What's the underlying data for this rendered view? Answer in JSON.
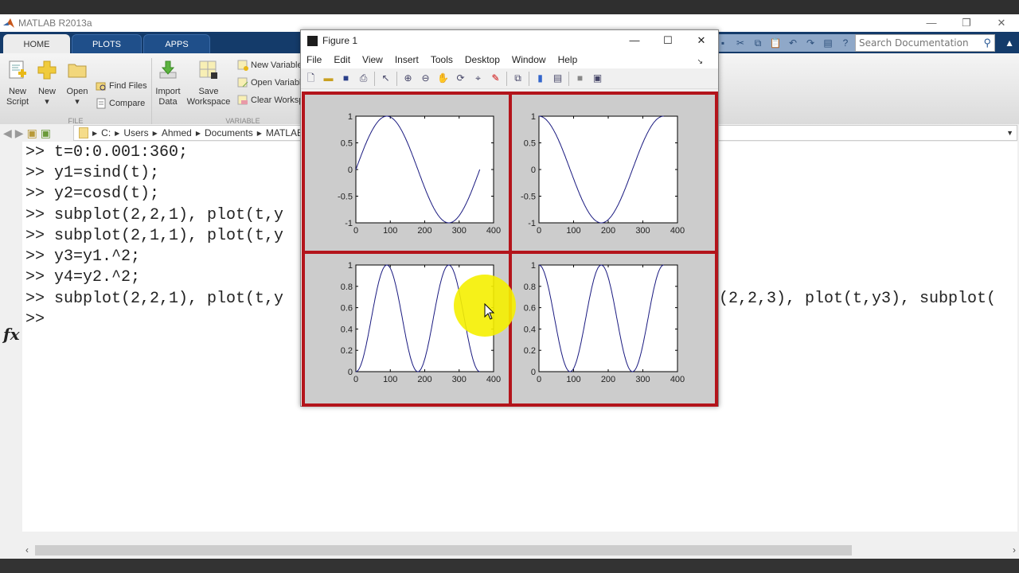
{
  "app": {
    "title": "MATLAB R2013a",
    "window_controls": [
      "minimize",
      "restore",
      "close"
    ],
    "tabs": [
      {
        "label": "HOME",
        "active": true
      },
      {
        "label": "PLOTS",
        "active": false
      },
      {
        "label": "APPS",
        "active": false
      }
    ],
    "search_placeholder": "Search Documentation"
  },
  "ribbon": {
    "file_group": {
      "label": "FILE",
      "buttons": [
        {
          "label_line1": "New",
          "label_line2": "Script",
          "icon": "new-script-icon"
        },
        {
          "label_line1": "New",
          "label_line2": "▾",
          "icon": "plus-icon"
        },
        {
          "label_line1": "Open",
          "label_line2": "▾",
          "icon": "folder-icon"
        }
      ],
      "small_buttons": [
        {
          "label": "Find Files",
          "icon": "find-files-icon"
        },
        {
          "label": "Compare",
          "icon": "compare-icon"
        }
      ]
    },
    "variable_group": {
      "label": "VARIABLE",
      "buttons": [
        {
          "label_line1": "Import",
          "label_line2": "Data",
          "icon": "import-icon"
        },
        {
          "label_line1": "Save",
          "label_line2": "Workspace",
          "icon": "save-workspace-icon"
        }
      ],
      "small_buttons": [
        {
          "label": "New Variable",
          "icon": "new-variable-icon"
        },
        {
          "label": "Open Variable",
          "icon": "open-variable-icon"
        },
        {
          "label": "Clear Workspace",
          "icon": "clear-workspace-icon"
        }
      ]
    }
  },
  "address_bar": {
    "path": [
      "C:",
      "Users",
      "Ahmed",
      "Documents",
      "MATLAB"
    ]
  },
  "command_window": {
    "prompt": ">>",
    "lines": [
      ">> t=0:0.001:360;",
      ">> y1=sind(t);",
      ">> y2=cosd(t);",
      ">> subplot(2,2,1), plot(t,y",
      ">> subplot(2,1,1), plot(t,y",
      ">> y3=y1.^2;",
      ">> y4=y2.^2;",
      ">> subplot(2,2,1), plot(t,y"
    ],
    "line8_tail": "(2,2,3), plot(t,y3), subplot(",
    "current_prompt": ">>",
    "fx_label": "fx"
  },
  "figure": {
    "title": "Figure 1",
    "menus": [
      "File",
      "Edit",
      "View",
      "Insert",
      "Tools",
      "Desktop",
      "Window",
      "Help"
    ],
    "toolbar_icons": [
      "new-figure-icon",
      "open-file-icon",
      "save-icon",
      "print-icon",
      "select-icon",
      "zoom-in-icon",
      "zoom-out-icon",
      "pan-icon",
      "rotate-icon",
      "data-cursor-icon",
      "brush-icon",
      "link-icon",
      "colorbar-icon",
      "legend-icon",
      "hide-plot-tools-icon",
      "show-plot-tools-icon"
    ]
  },
  "chart_data": [
    {
      "type": "line",
      "title": "",
      "function": "sind(t)",
      "x_range": [
        0,
        360
      ],
      "xlim": [
        0,
        400
      ],
      "ylim": [
        -1,
        1
      ],
      "xticks": [
        "0",
        "100",
        "200",
        "300",
        "400"
      ],
      "yticks": [
        "-1",
        "-0.5",
        "0",
        "0.5",
        "1"
      ],
      "series": [
        {
          "name": "y1",
          "x": [
            0,
            45,
            90,
            135,
            180,
            225,
            270,
            315,
            360
          ],
          "y": [
            0,
            0.707,
            1,
            0.707,
            0,
            -0.707,
            -1,
            -0.707,
            0
          ]
        }
      ]
    },
    {
      "type": "line",
      "title": "",
      "function": "cosd(t)",
      "x_range": [
        0,
        360
      ],
      "xlim": [
        0,
        400
      ],
      "ylim": [
        -1,
        1
      ],
      "xticks": [
        "0",
        "100",
        "200",
        "300",
        "400"
      ],
      "yticks": [
        "-1",
        "-0.5",
        "0",
        "0.5",
        "1"
      ],
      "series": [
        {
          "name": "y2",
          "x": [
            0,
            45,
            90,
            135,
            180,
            225,
            270,
            315,
            360
          ],
          "y": [
            1,
            0.707,
            0,
            -0.707,
            -1,
            -0.707,
            0,
            0.707,
            1
          ]
        }
      ]
    },
    {
      "type": "line",
      "title": "",
      "function": "sind(t).^2",
      "x_range": [
        0,
        360
      ],
      "xlim": [
        0,
        400
      ],
      "ylim": [
        0,
        1
      ],
      "xticks": [
        "0",
        "100",
        "200",
        "300",
        "400"
      ],
      "yticks": [
        "0",
        "0.2",
        "0.4",
        "0.6",
        "0.8",
        "1"
      ],
      "series": [
        {
          "name": "y3",
          "x": [
            0,
            45,
            90,
            135,
            180,
            225,
            270,
            315,
            360
          ],
          "y": [
            0,
            0.5,
            1,
            0.5,
            0,
            0.5,
            1,
            0.5,
            0
          ]
        }
      ]
    },
    {
      "type": "line",
      "title": "",
      "function": "cosd(t).^2",
      "x_range": [
        0,
        360
      ],
      "xlim": [
        0,
        400
      ],
      "ylim": [
        0,
        1
      ],
      "xticks": [
        "0",
        "100",
        "200",
        "300",
        "400"
      ],
      "yticks": [
        "0",
        "0.2",
        "0.4",
        "0.6",
        "0.8",
        "1"
      ],
      "series": [
        {
          "name": "y4",
          "x": [
            0,
            45,
            90,
            135,
            180,
            225,
            270,
            315,
            360
          ],
          "y": [
            1,
            0.5,
            0,
            0.5,
            1,
            0.5,
            0,
            0.5,
            1
          ]
        }
      ]
    }
  ],
  "colors": {
    "tab_strip": "#143b6a",
    "annotation_red": "#b3141b",
    "plot_line": "#1a1a80",
    "cursor_highlight": "#f5ef00"
  }
}
